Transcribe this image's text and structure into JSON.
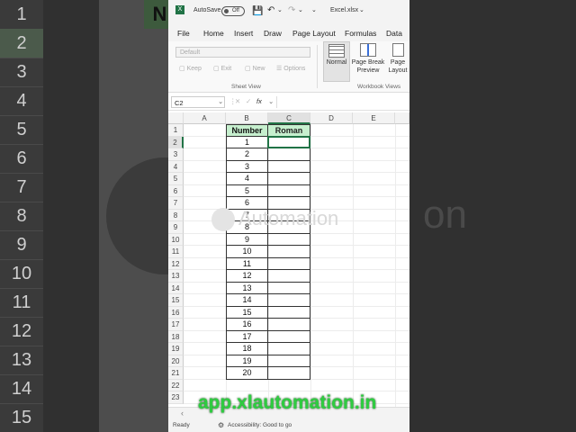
{
  "background": {
    "rows": [
      "1",
      "2",
      "3",
      "4",
      "5",
      "6",
      "7",
      "8",
      "9",
      "10",
      "11",
      "12",
      "13",
      "14",
      "15"
    ],
    "header_fragment": "N",
    "watermark_tail": "on"
  },
  "titlebar": {
    "autosave_label": "AutoSave",
    "toggle_state": "Off",
    "filename": "Excel.xlsx"
  },
  "menu": [
    "File",
    "Home",
    "Insert",
    "Draw",
    "Page Layout",
    "Formulas",
    "Data"
  ],
  "ribbon": {
    "sheet_view_dropdown": "Default",
    "keep": "Keep",
    "exit": "Exit",
    "new": "New",
    "options": "Options",
    "sheet_view_group": "Sheet View",
    "normal": "Normal",
    "page_break_preview": "Page Break Preview",
    "page_layout": "Page Layout",
    "workbook_views_group": "Workbook Views"
  },
  "formula_bar": {
    "name_box": "C2",
    "fx": "fx"
  },
  "columns": [
    "A",
    "B",
    "C",
    "D",
    "E"
  ],
  "row_numbers": [
    "1",
    "2",
    "3",
    "4",
    "5",
    "6",
    "7",
    "8",
    "9",
    "10",
    "11",
    "12",
    "13",
    "14",
    "15",
    "16",
    "17",
    "18",
    "19",
    "20",
    "21",
    "22",
    "23"
  ],
  "table": {
    "header_number": "Number",
    "header_roman": "Roman",
    "numbers": [
      "1",
      "2",
      "3",
      "4",
      "5",
      "6",
      "7",
      "8",
      "9",
      "10",
      "11",
      "12",
      "13",
      "14",
      "15",
      "16",
      "17",
      "18",
      "19",
      "20"
    ]
  },
  "watermark": "Automation",
  "overlay_url": "app.xlautomation.in",
  "status": {
    "ready": "Ready",
    "accessibility": "Accessibility: Good to go"
  }
}
